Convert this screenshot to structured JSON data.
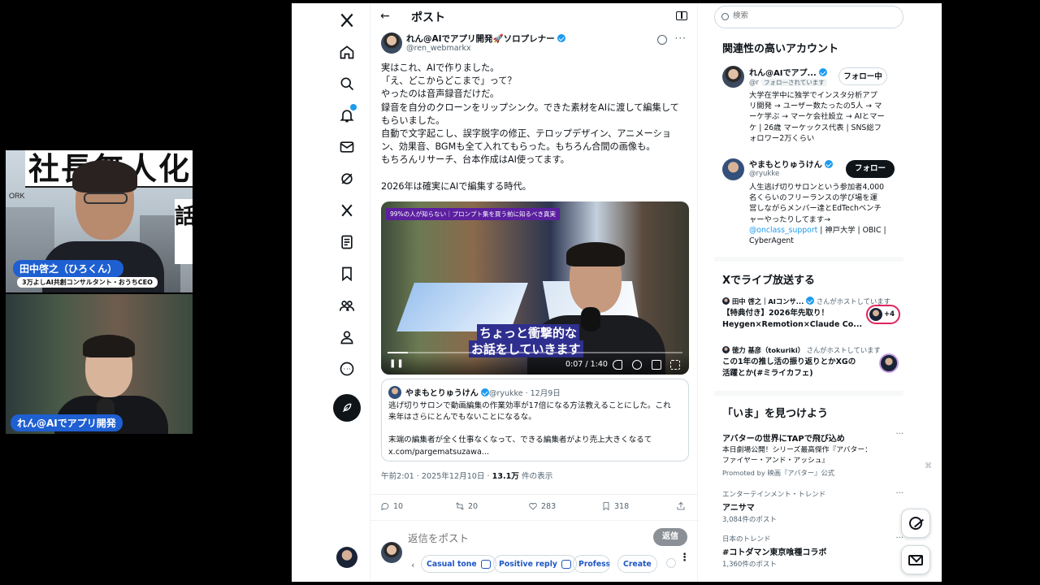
{
  "call": {
    "person1": {
      "sign_text": "社長無人化",
      "sign_side": "話",
      "bg_text": "ORK",
      "name": "田中啓之（ひろくん）",
      "subtitle": "3万よしAI共創コンサルタント・おうちCEO"
    },
    "person2": {
      "name": "れん@AIでアプリ開発"
    }
  },
  "nav": {
    "icons": [
      "x-logo-icon",
      "home-icon",
      "search-icon",
      "bell-icon",
      "mail-icon",
      "grok-icon",
      "x-premium-icon",
      "lists-icon",
      "bookmark-icon",
      "communities-icon",
      "profile-icon",
      "more-icon"
    ]
  },
  "header": {
    "back": "←",
    "title": "ポスト"
  },
  "post": {
    "author_name": "れん@AIでアプリ開発🚀ソロプレナー",
    "author_handle": "@ren_webmarkx",
    "lines": [
      "実はこれ、AIで作りました。",
      "「え、どこからどこまで」って？",
      "やったのは音声録音だけだ。",
      "録音を自分のクローンをリップシンク。できた素材をAIに渡して編集して",
      "もらいました。",
      "自動で文字起こし、誤字脱字の修正、テロップデザイン、アニメーショ",
      "ン、効果音、BGMも全て入れてもらった。もちろん合間の画像も。",
      "もちろんリサーチ、台本作成はAI使ってます。",
      "",
      "2026年は確実にAIで編集する時代。"
    ],
    "video": {
      "top_caption": "99%の人が知らない｜プロンプト集を買う前に知るべき真実",
      "subtitle_line1": "ちょっと衝撃的な",
      "subtitle_line2": "お話をしていきます",
      "time": "0:07 / 1:40",
      "progress": 0.07
    },
    "quote": {
      "author_name": "やまもとりゅうけん",
      "author_handle": "@ryukke · 12月9日",
      "lines": [
        "逃げ切りサロンで動画編集の作業効率が17倍になる方法教えることにした。これ",
        "来年はさらにとんでもないことになるな。",
        "",
        "末端の編集者が全く仕事なくなって、できる編集者がより売上大きくなるて",
        "x.com/pargematsuzawa..."
      ]
    },
    "meta_time": "午前2:01 · 2025年12月10日 · ",
    "meta_views": "13.1万",
    "meta_views_suffix": " 件の表示",
    "actions": {
      "replies": "10",
      "reposts": "20",
      "likes": "283",
      "bookmarks": "318"
    }
  },
  "reply": {
    "placeholder": "返信をポスト",
    "button": "返信",
    "chips": [
      "Casual tone",
      "Positive reply",
      "Professional",
      "Create"
    ],
    "chip_prev": "‹",
    "chip_more_dots": "⋮"
  },
  "sidebar": {
    "search_placeholder": "検索",
    "relevant_title": "関連性の高いアカウント",
    "accounts": [
      {
        "name": "れん@AIでアプ...",
        "handle": "@r",
        "follows_you": "フォローされています",
        "button": "フォロー中",
        "bio": [
          "大学在学中に独学でインスタ分析アプ",
          "リ開発 → ユーザー数たったの5人 → マ",
          "ーケ学ぶ → マーケ会社設立 → AIとマー",
          "ケ | 26歳 マーケックス代表 | SNS総フ",
          "ォロワー2万くらい"
        ]
      },
      {
        "name": "やまもとりゅうけん",
        "handle": "@ryukke",
        "button": "フォロー",
        "bio": [
          "人生逃げ切りサロンという参加者4,000",
          "名くらいのフリーランスの学び場を運",
          "営しながらメンバー達とEdTechベンチ",
          "ャーやったりしてます→"
        ],
        "bio_link": "@onclass_support",
        "bio_after_link": " | 神戸大学 | OBIC |",
        "bio_last": "CyberAgent"
      }
    ],
    "live_title": "Xでライブ放送する",
    "live": [
      {
        "host": "田中 啓之｜AIコンサ...",
        "host_suffix": "さんがホストしています",
        "title_lines": [
          "【特典付き】2026年先取り！",
          "Heygen×Remotion×Claude Co..."
        ],
        "badge": "+4"
      },
      {
        "host": "徳力 基彦（tokuriki）",
        "host_suffix": "さんがホストしています",
        "title_lines": [
          "この1年の推し活の振り返りとかXGの",
          "活躍とか(#ミライカフェ)"
        ]
      }
    ],
    "trends_title": "「いま」を見つけよう",
    "trends": [
      {
        "category": "",
        "name": "アバターの世界にTAPで飛び込め",
        "desc": [
          "本日劇場公開！シリーズ最高傑作『アバター：",
          "ファイヤー・アンド・アッシュ』"
        ],
        "promo": "Promoted by 映画『アバター』公式"
      },
      {
        "category": "エンターテインメント・トレンド",
        "name": "アニサマ",
        "count": "3,084件のポスト"
      },
      {
        "category": "日本のトレンド",
        "name": "#コトダマン東京喰種コラボ",
        "count": "1,360件のポスト"
      }
    ]
  },
  "colors": {
    "accent": "#1d9bf0",
    "text": "#0f1419",
    "muted": "#536471",
    "name_tag": "#1e5fd1"
  }
}
